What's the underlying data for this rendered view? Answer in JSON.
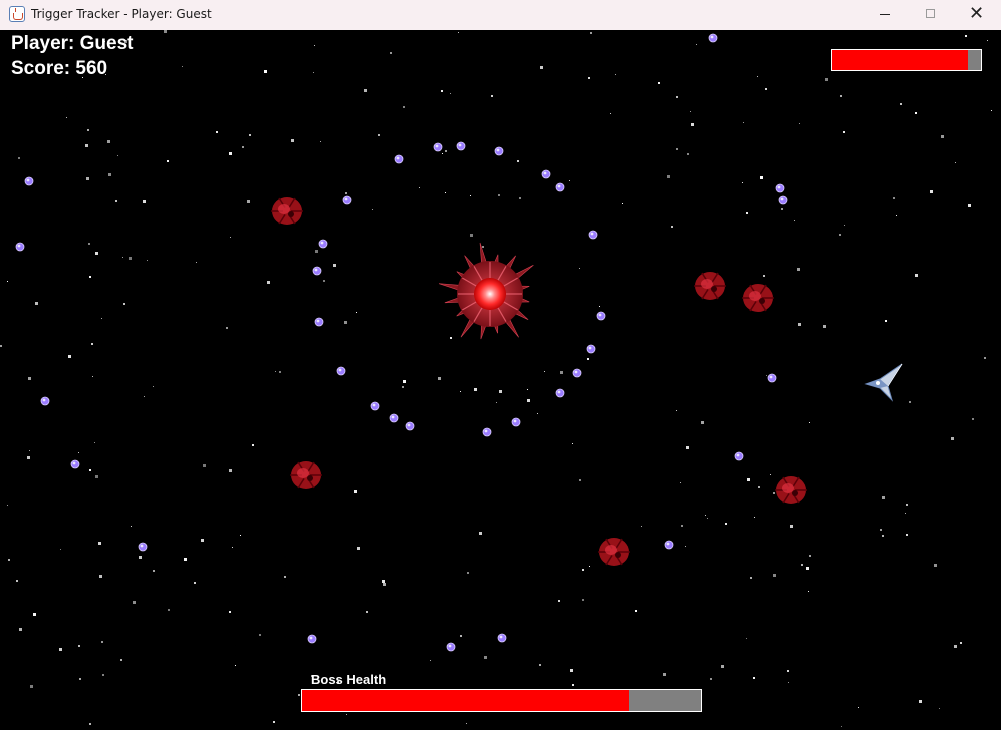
{
  "window": {
    "title": "Trigger Tracker - Player: Guest",
    "controls": {
      "minimize": "—",
      "maximize": "☐",
      "close": "✕"
    }
  },
  "hud": {
    "player_text": "Player: Guest",
    "score_text": "Score: 560",
    "player_health_fraction": 0.91,
    "boss_label": "Boss Health",
    "boss_health_fraction": 0.82
  },
  "colors": {
    "background": "#000000",
    "health_fill": "#ff0000",
    "health_empty": "#808080",
    "bullet": "#9b7dff",
    "enemy": "#b3141c",
    "boss_core": "#ff3b3b"
  },
  "icons": {
    "app": "java-cup-icon",
    "player_ship": "player-ship",
    "enemy": "red-drone-enemy",
    "boss": "spiked-boss-orb"
  },
  "counts": {
    "bullets": 45,
    "enemies": 7
  }
}
